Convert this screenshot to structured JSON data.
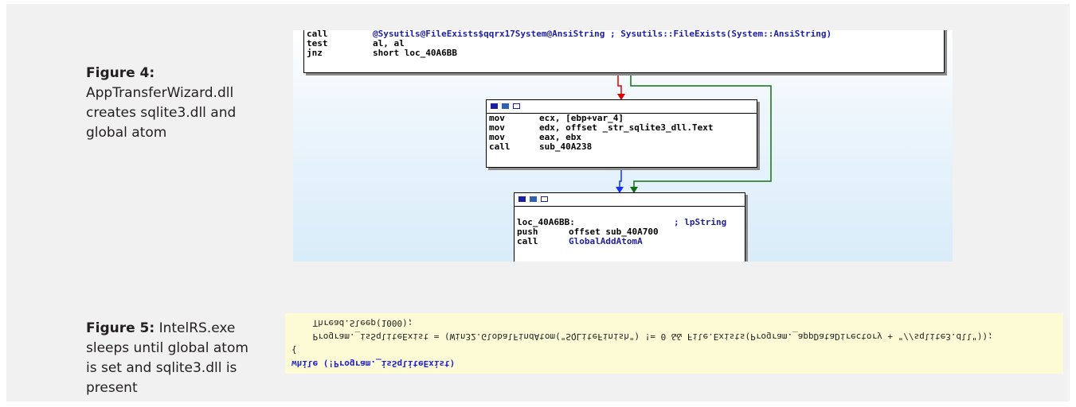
{
  "figure4": {
    "label": "Figure 4:",
    "text": "AppTransferWizard.dll creates sqlite3.dll and global atom"
  },
  "figure5": {
    "label": "Figure 5:",
    "text": "IntelRS.exe sleeps until global atom is set and sqlite3.dll is present"
  },
  "ida": {
    "colors": {
      "edge_false": "#e00000",
      "edge_true": "#107010",
      "edge_flow": "#1030ff"
    },
    "block1": {
      "rows": [
        {
          "op": "call",
          "arg": "@Sysutils@FileExists$qqrx17System@AnsiString ; Sysutils::FileExists(System::AnsiString)"
        },
        {
          "op": "test",
          "arg": "al, al"
        },
        {
          "op": "jnz",
          "arg": "short loc_40A6BB"
        }
      ]
    },
    "block2": {
      "rows": [
        {
          "op": "mov",
          "arg": "ecx, [ebp+var_4]"
        },
        {
          "op": "mov",
          "arg": "edx, offset _str_sqlite3_dll.Text"
        },
        {
          "op": "mov",
          "arg": "eax, ebx"
        },
        {
          "op": "call",
          "arg": "sub_40A238"
        }
      ]
    },
    "block3": {
      "label": "loc_40A6BB:",
      "comment": "; lpString",
      "rows": [
        {
          "op": "push",
          "arg": "offset sub_40A700"
        },
        {
          "op": "call",
          "arg": "GlobalAddAtomA"
        }
      ]
    },
    "header_icons": [
      "graph-icon",
      "edit-icon",
      "window-icon"
    ]
  },
  "code": {
    "lines": [
      "while (!Program._isSqliteExist)",
      "{",
      "    Program._isSqliteExist = (Win32.GlobalFindAtom(\"SQLiteFinish\") != 0 && File.Exists(Program._appDataDirectory + \"//sqlite3.dll\"));",
      "    Thread.Sleep(1000);",
      "}"
    ]
  }
}
